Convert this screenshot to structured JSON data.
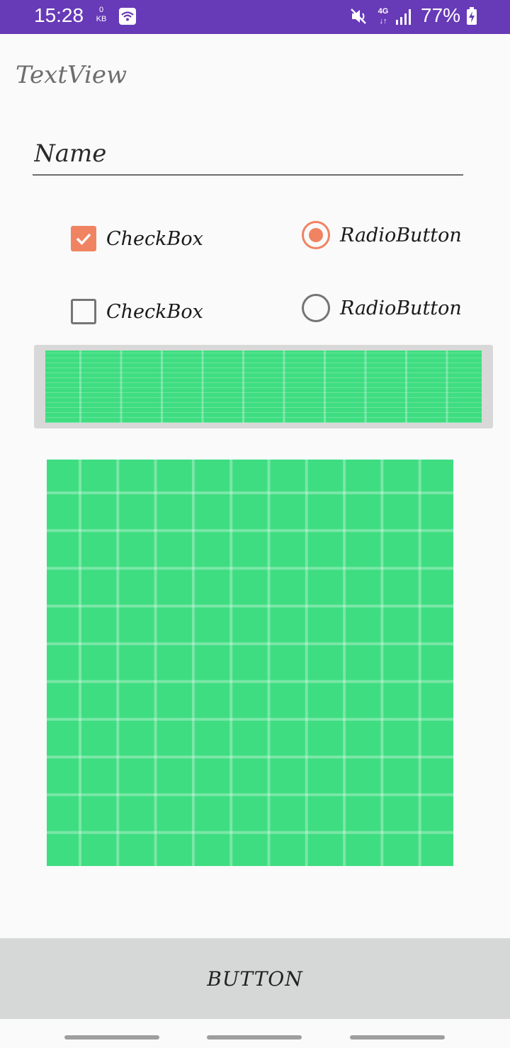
{
  "status_bar": {
    "time": "15:28",
    "net_speed_value": "0",
    "net_speed_unit": "KB",
    "network_type_top": "4G",
    "network_type_bottom": "↓↑",
    "battery_percent": "77%",
    "background_color": "#673ab7"
  },
  "content": {
    "textview": "TextView",
    "name_field": {
      "placeholder": "Name",
      "value": ""
    },
    "checkboxes": [
      {
        "label": "CheckBox",
        "checked": true
      },
      {
        "label": "CheckBox",
        "checked": false
      }
    ],
    "radio_buttons": [
      {
        "label": "RadioButton",
        "checked": true
      },
      {
        "label": "RadioButton",
        "checked": false
      }
    ],
    "accent_color": "#f08362",
    "image_color": "#3fdd81"
  },
  "button": {
    "label": "BUTTON"
  },
  "nav_bar": {
    "items": [
      "recents",
      "home",
      "back"
    ]
  }
}
